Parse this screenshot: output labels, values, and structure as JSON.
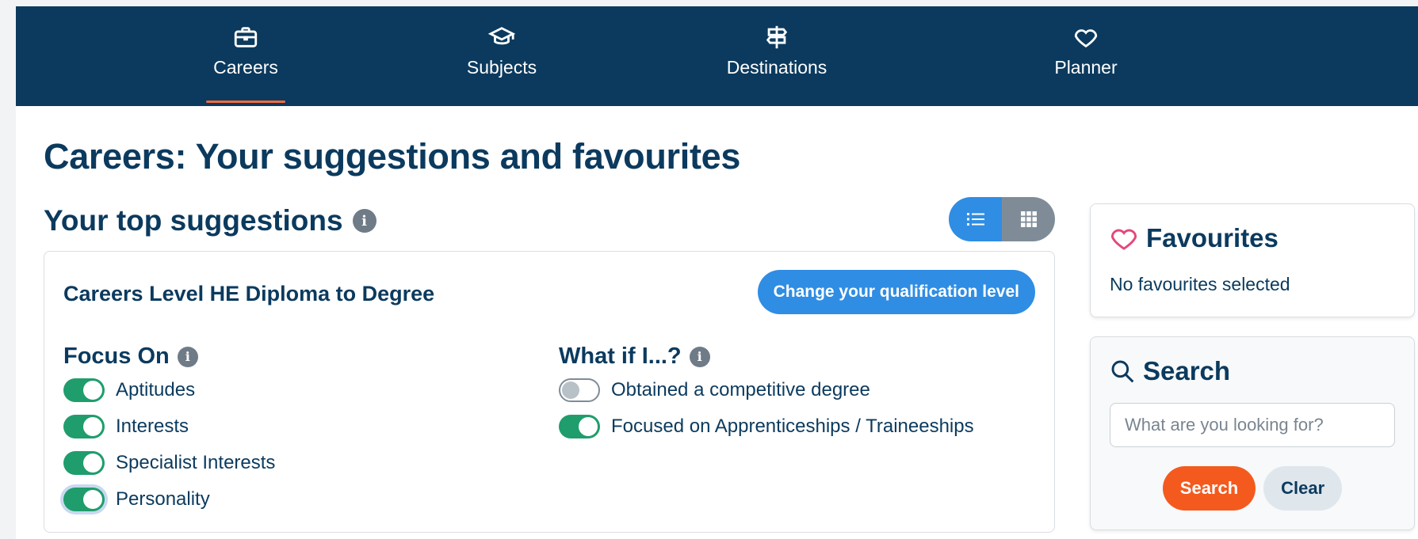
{
  "nav": {
    "items": [
      {
        "label": "Careers",
        "icon": "briefcase-icon",
        "active": true
      },
      {
        "label": "Subjects",
        "icon": "graduation-cap-icon",
        "active": false
      },
      {
        "label": "Destinations",
        "icon": "signpost-icon",
        "active": false
      },
      {
        "label": "Planner",
        "icon": "heart-icon",
        "active": false
      }
    ]
  },
  "page": {
    "title": "Careers: Your suggestions and favourites"
  },
  "suggestions": {
    "title": "Your top suggestions",
    "view_toggle": {
      "list_icon": "list-view-icon",
      "grid_icon": "grid-view-icon",
      "selected": "list"
    },
    "level_heading": "Careers Level HE Diploma to Degree",
    "change_level_button": "Change your qualification level",
    "focus_on": {
      "title": "Focus On",
      "toggles": [
        {
          "label": "Aptitudes",
          "on": true
        },
        {
          "label": "Interests",
          "on": true
        },
        {
          "label": "Specialist Interests",
          "on": true
        },
        {
          "label": "Personality",
          "on": true
        }
      ]
    },
    "what_if": {
      "title": "What if I...?",
      "toggles": [
        {
          "label": "Obtained a competitive degree",
          "on": false
        },
        {
          "label": "Focused on Apprenticeships / Traineeships",
          "on": true
        }
      ]
    }
  },
  "favourites": {
    "title": "Favourites",
    "empty_text": "No favourites selected"
  },
  "search": {
    "title": "Search",
    "placeholder": "What are you looking for?",
    "value": "",
    "search_button": "Search",
    "clear_button": "Clear"
  },
  "colors": {
    "nav_bg": "#0b3a5e",
    "active_underline": "#f26a3d",
    "primary_blue": "#2f8de4",
    "toggle_on": "#1f9d6c",
    "search_orange": "#f45a1e",
    "heart_pink": "#e5487a"
  }
}
